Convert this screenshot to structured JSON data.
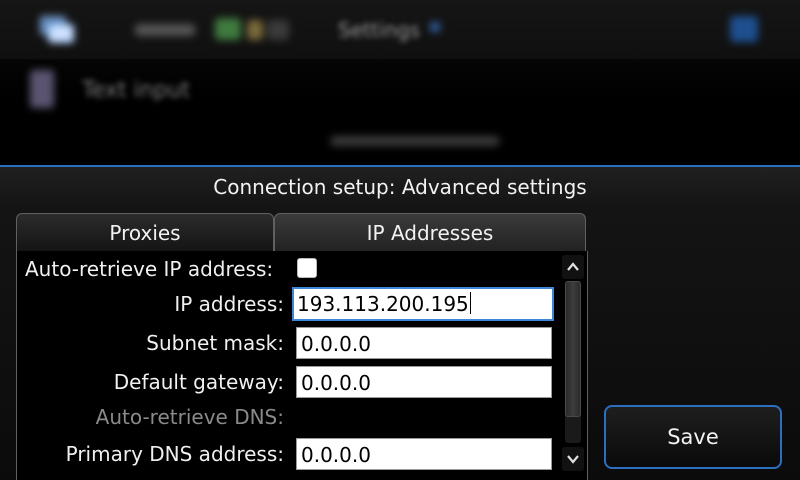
{
  "background": {
    "header_label": "Settings",
    "list_item_label": "Text input"
  },
  "dialog": {
    "title": "Connection setup: Advanced settings",
    "tabs": [
      {
        "label": "Proxies",
        "active": false
      },
      {
        "label": "IP Addresses",
        "active": true
      }
    ],
    "fields": {
      "auto_retrieve_ip": {
        "label": "Auto-retrieve IP address:",
        "checked": false
      },
      "ip_address": {
        "label": "IP address:",
        "value": "193.113.200.195"
      },
      "subnet_mask": {
        "label": "Subnet mask:",
        "value": "0.0.0.0"
      },
      "default_gateway": {
        "label": "Default gateway:",
        "value": "0.0.0.0"
      },
      "auto_retrieve_dns": {
        "label": "Auto-retrieve DNS:",
        "enabled": false
      },
      "primary_dns": {
        "label": "Primary DNS address:",
        "value": "0.0.0.0"
      }
    },
    "save_label": "Save"
  },
  "colors": {
    "accent": "#2c6fbf",
    "focus": "#3d86d8",
    "disabled_text": "#8a8a8a"
  },
  "icons": {
    "app": "task-switcher-icon",
    "close": "close-icon",
    "scroll_up": "chevron-up-icon",
    "scroll_down": "chevron-down-icon"
  }
}
